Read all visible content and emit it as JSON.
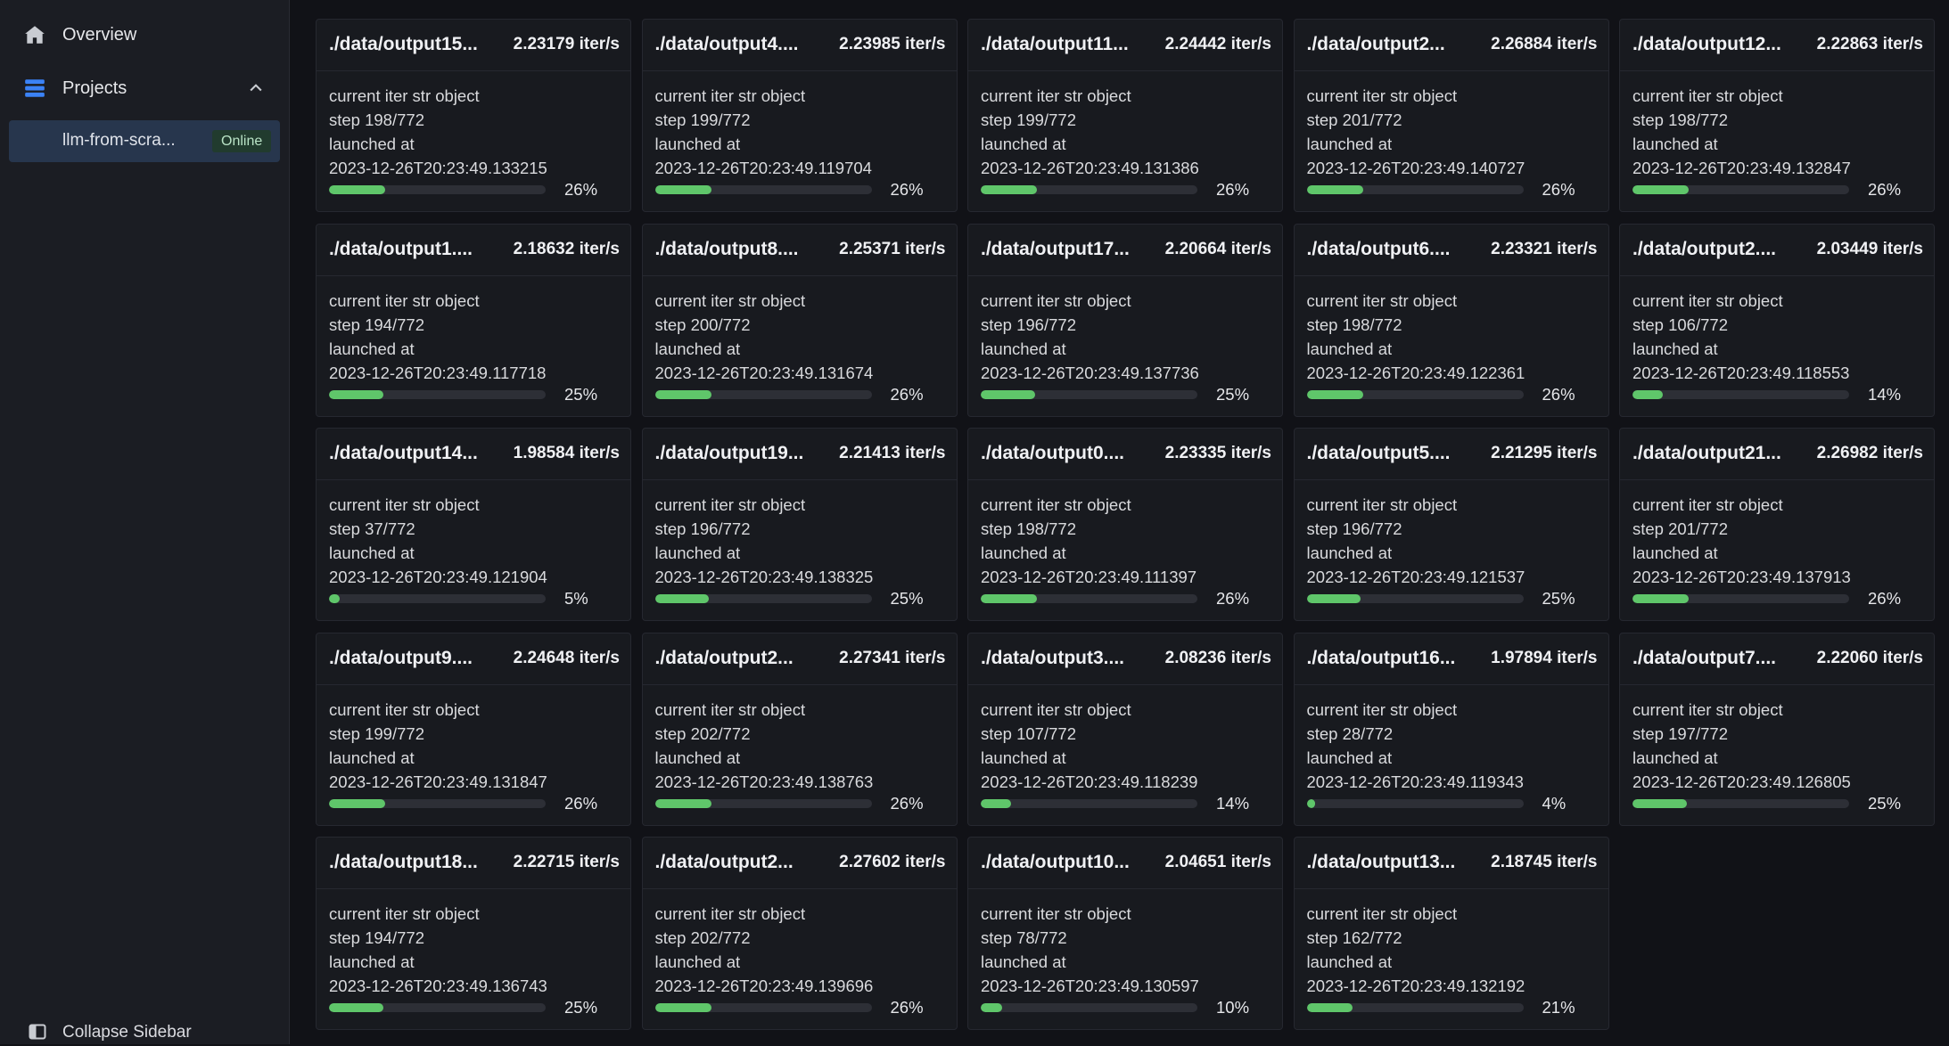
{
  "sidebar": {
    "overview_label": "Overview",
    "projects_label": "Projects",
    "project": {
      "name": "llm-from-scra...",
      "status": "Online"
    },
    "collapse_label": "Collapse Sidebar",
    "icons": {
      "overview": "home-icon",
      "projects": "stack-icon",
      "chevron": "chevron-up-icon",
      "collapse": "sidebar-panel-icon"
    }
  },
  "cards": [
    {
      "title": "./data/output15...",
      "rate": "2.23179 iter/s",
      "line1": "current iter str object",
      "step": "step 198/772",
      "launched": "launched at",
      "time": "2023-12-26T20:23:49.133215",
      "percent": "26%",
      "progress": 26
    },
    {
      "title": "./data/output4....",
      "rate": "2.23985 iter/s",
      "line1": "current iter str object",
      "step": "step 199/772",
      "launched": "launched at",
      "time": "2023-12-26T20:23:49.119704",
      "percent": "26%",
      "progress": 26
    },
    {
      "title": "./data/output11...",
      "rate": "2.24442 iter/s",
      "line1": "current iter str object",
      "step": "step 199/772",
      "launched": "launched at",
      "time": "2023-12-26T20:23:49.131386",
      "percent": "26%",
      "progress": 26
    },
    {
      "title": "./data/output2...",
      "rate": "2.26884 iter/s",
      "line1": "current iter str object",
      "step": "step 201/772",
      "launched": "launched at",
      "time": "2023-12-26T20:23:49.140727",
      "percent": "26%",
      "progress": 26
    },
    {
      "title": "./data/output12...",
      "rate": "2.22863 iter/s",
      "line1": "current iter str object",
      "step": "step 198/772",
      "launched": "launched at",
      "time": "2023-12-26T20:23:49.132847",
      "percent": "26%",
      "progress": 26
    },
    {
      "title": "./data/output1....",
      "rate": "2.18632 iter/s",
      "line1": "current iter str object",
      "step": "step 194/772",
      "launched": "launched at",
      "time": "2023-12-26T20:23:49.117718",
      "percent": "25%",
      "progress": 25
    },
    {
      "title": "./data/output8....",
      "rate": "2.25371 iter/s",
      "line1": "current iter str object",
      "step": "step 200/772",
      "launched": "launched at",
      "time": "2023-12-26T20:23:49.131674",
      "percent": "26%",
      "progress": 26
    },
    {
      "title": "./data/output17...",
      "rate": "2.20664 iter/s",
      "line1": "current iter str object",
      "step": "step 196/772",
      "launched": "launched at",
      "time": "2023-12-26T20:23:49.137736",
      "percent": "25%",
      "progress": 25
    },
    {
      "title": "./data/output6....",
      "rate": "2.23321 iter/s",
      "line1": "current iter str object",
      "step": "step 198/772",
      "launched": "launched at",
      "time": "2023-12-26T20:23:49.122361",
      "percent": "26%",
      "progress": 26
    },
    {
      "title": "./data/output2....",
      "rate": "2.03449 iter/s",
      "line1": "current iter str object",
      "step": "step 106/772",
      "launched": "launched at",
      "time": "2023-12-26T20:23:49.118553",
      "percent": "14%",
      "progress": 14
    },
    {
      "title": "./data/output14...",
      "rate": "1.98584 iter/s",
      "line1": "current iter str object",
      "step": "step 37/772",
      "launched": "launched at",
      "time": "2023-12-26T20:23:49.121904",
      "percent": "5%",
      "progress": 5
    },
    {
      "title": "./data/output19...",
      "rate": "2.21413 iter/s",
      "line1": "current iter str object",
      "step": "step 196/772",
      "launched": "launched at",
      "time": "2023-12-26T20:23:49.138325",
      "percent": "25%",
      "progress": 25
    },
    {
      "title": "./data/output0....",
      "rate": "2.23335 iter/s",
      "line1": "current iter str object",
      "step": "step 198/772",
      "launched": "launched at",
      "time": "2023-12-26T20:23:49.111397",
      "percent": "26%",
      "progress": 26
    },
    {
      "title": "./data/output5....",
      "rate": "2.21295 iter/s",
      "line1": "current iter str object",
      "step": "step 196/772",
      "launched": "launched at",
      "time": "2023-12-26T20:23:49.121537",
      "percent": "25%",
      "progress": 25
    },
    {
      "title": "./data/output21...",
      "rate": "2.26982 iter/s",
      "line1": "current iter str object",
      "step": "step 201/772",
      "launched": "launched at",
      "time": "2023-12-26T20:23:49.137913",
      "percent": "26%",
      "progress": 26
    },
    {
      "title": "./data/output9....",
      "rate": "2.24648 iter/s",
      "line1": "current iter str object",
      "step": "step 199/772",
      "launched": "launched at",
      "time": "2023-12-26T20:23:49.131847",
      "percent": "26%",
      "progress": 26
    },
    {
      "title": "./data/output2...",
      "rate": "2.27341 iter/s",
      "line1": "current iter str object",
      "step": "step 202/772",
      "launched": "launched at",
      "time": "2023-12-26T20:23:49.138763",
      "percent": "26%",
      "progress": 26
    },
    {
      "title": "./data/output3....",
      "rate": "2.08236 iter/s",
      "line1": "current iter str object",
      "step": "step 107/772",
      "launched": "launched at",
      "time": "2023-12-26T20:23:49.118239",
      "percent": "14%",
      "progress": 14
    },
    {
      "title": "./data/output16...",
      "rate": "1.97894 iter/s",
      "line1": "current iter str object",
      "step": "step 28/772",
      "launched": "launched at",
      "time": "2023-12-26T20:23:49.119343",
      "percent": "4%",
      "progress": 4
    },
    {
      "title": "./data/output7....",
      "rate": "2.22060 iter/s",
      "line1": "current iter str object",
      "step": "step 197/772",
      "launched": "launched at",
      "time": "2023-12-26T20:23:49.126805",
      "percent": "25%",
      "progress": 25
    },
    {
      "title": "./data/output18...",
      "rate": "2.22715 iter/s",
      "line1": "current iter str object",
      "step": "step 194/772",
      "launched": "launched at",
      "time": "2023-12-26T20:23:49.136743",
      "percent": "25%",
      "progress": 25
    },
    {
      "title": "./data/output2...",
      "rate": "2.27602 iter/s",
      "line1": "current iter str object",
      "step": "step 202/772",
      "launched": "launched at",
      "time": "2023-12-26T20:23:49.139696",
      "percent": "26%",
      "progress": 26
    },
    {
      "title": "./data/output10...",
      "rate": "2.04651 iter/s",
      "line1": "current iter str object",
      "step": "step 78/772",
      "launched": "launched at",
      "time": "2023-12-26T20:23:49.130597",
      "percent": "10%",
      "progress": 10
    },
    {
      "title": "./data/output13...",
      "rate": "2.18745 iter/s",
      "line1": "current iter str object",
      "step": "step 162/772",
      "launched": "launched at",
      "time": "2023-12-26T20:23:49.132192",
      "percent": "21%",
      "progress": 21
    }
  ],
  "colors": {
    "progress_fill": "#5fc66a",
    "accent": "#3b82f6",
    "online_badge": "#213b2e"
  }
}
